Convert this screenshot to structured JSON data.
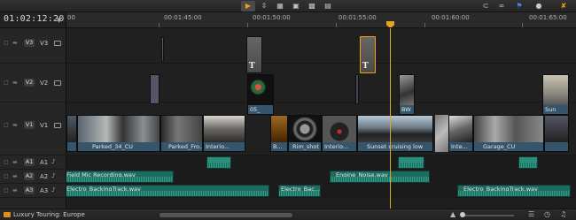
{
  "toolbar": {
    "icons": [
      "select-tool",
      "trim-tool",
      "blade-tool",
      "insert-edit",
      "overwrite-edit",
      "replace-edit",
      "snapping",
      "linked-selection",
      "flag",
      "marker",
      "settings"
    ]
  },
  "timecode": "01:02:12:20",
  "ruler": {
    "labels": [
      "00",
      "00:01:45:00",
      "00:01:50:00",
      "00:01:55:00",
      "00:01:60:00",
      "00:01:65:00"
    ]
  },
  "tracks": {
    "video": [
      {
        "id": "V3",
        "label": "V3"
      },
      {
        "id": "V2",
        "label": "V2"
      },
      {
        "id": "V1",
        "label": "V1"
      }
    ],
    "audio": [
      {
        "id": "A1",
        "label": "A1"
      },
      {
        "id": "A2",
        "label": "A2"
      },
      {
        "id": "A3",
        "label": "A3"
      }
    ]
  },
  "clips": {
    "v3": [
      {
        "name": "T"
      },
      {
        "name": "T"
      }
    ],
    "v2": [
      {
        "name": "05_"
      },
      {
        "name": "BW"
      },
      {
        "name": "Sun"
      }
    ],
    "v1": [
      {
        "name": "Parked_34_CU"
      },
      {
        "name": "Parked_Fro..."
      },
      {
        "name": "Interio..."
      },
      {
        "name": "B..."
      },
      {
        "name": "Rim_shot 0..."
      },
      {
        "name": "Interio..."
      },
      {
        "name": "Sunset cruising low"
      },
      {
        "name": "Inte..."
      },
      {
        "name": "Garage_CU"
      }
    ],
    "a2": [
      {
        "name": "Field Mic Recording.wav"
      },
      {
        "name": "Engine_Noise.wav"
      }
    ],
    "a3": [
      {
        "name": "Electro_BackingTrack.wav"
      },
      {
        "name": "Electro_Bac..."
      },
      {
        "name": "Electro_BackingTrack.wav"
      }
    ]
  },
  "project": {
    "name": "Luxury Touring: Europe"
  },
  "colors": {
    "accent": "#e8a321",
    "audio_clip": "#1f6c5e",
    "video_bar": "#35556c"
  }
}
